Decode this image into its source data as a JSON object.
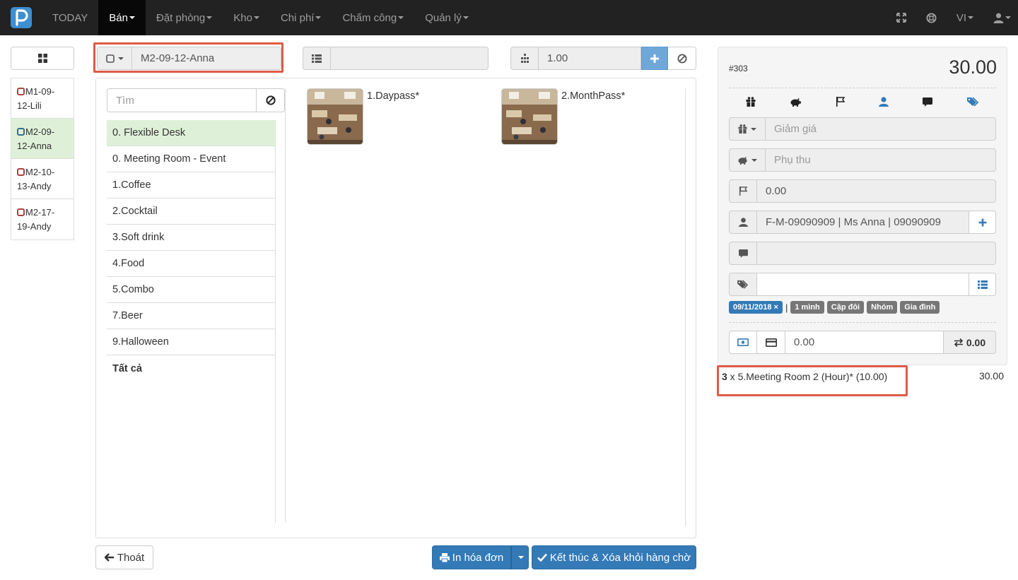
{
  "nav": {
    "items": [
      {
        "label": "TODAY",
        "dropdown": false,
        "active": false
      },
      {
        "label": "Bán",
        "dropdown": true,
        "active": true
      },
      {
        "label": "Đặt phòng",
        "dropdown": true,
        "active": false
      },
      {
        "label": "Kho",
        "dropdown": true,
        "active": false
      },
      {
        "label": "Chi phí",
        "dropdown": true,
        "active": false
      },
      {
        "label": "Chấm công",
        "dropdown": true,
        "active": false
      },
      {
        "label": "Quản lý",
        "dropdown": true,
        "active": false
      }
    ],
    "language": "VI"
  },
  "queue": {
    "items": [
      {
        "label": "M1-09-12-Lili",
        "line1": "M1-09-",
        "line2": "12-Lili"
      },
      {
        "label": "M2-09-12-Anna",
        "line1": "M2-09-",
        "line2": "12-Anna"
      },
      {
        "label": "M2-10-13-Andy",
        "line1": "M2-10-",
        "line2": "13-Andy"
      },
      {
        "label": "M2-17-19-Andy",
        "line1": "M2-17-",
        "line2": "19-Andy"
      }
    ]
  },
  "top": {
    "order_name": "M2-09-12-Anna",
    "table_value": "",
    "quantity": "1.00"
  },
  "search": {
    "placeholder": "Tìm"
  },
  "categories": [
    "0. Flexible Desk",
    "0. Meeting Room - Event",
    "1.Coffee",
    "2.Cocktail",
    "3.Soft drink",
    "4.Food",
    "5.Combo",
    "7.Beer",
    "9.Halloween",
    "Tất cả"
  ],
  "products": [
    {
      "name": "1.Daypass*"
    },
    {
      "name": "2.MonthPass*"
    }
  ],
  "buttons": {
    "exit": "Thoát",
    "print": "In hóa đơn",
    "finish": "Kết thúc & Xóa khỏi hàng chờ"
  },
  "order": {
    "id": "#303",
    "total": "30.00",
    "discount_placeholder": "Giảm giá",
    "surcharge_placeholder": "Phụ thu",
    "flag_value": "0.00",
    "customer": "F-M-09090909 | Ms Anna | 09090909",
    "note": "",
    "tag_input": "",
    "tags": {
      "date": "09/11/2018 ×",
      "separator": "|",
      "options": [
        "1 mình",
        "Cặp đôi",
        "Nhóm",
        "Gia đình"
      ]
    },
    "payment_value": "0.00",
    "change_value": "0.00",
    "line": {
      "qty": "3",
      "desc": " x 5.Meeting Room 2 (Hour)* (10.00)",
      "amount": "30.00"
    }
  },
  "colors": {
    "navbar": "#222222",
    "accent": "#337ab7",
    "highlight": "#e05a47",
    "active_row": "#dff0d8"
  }
}
